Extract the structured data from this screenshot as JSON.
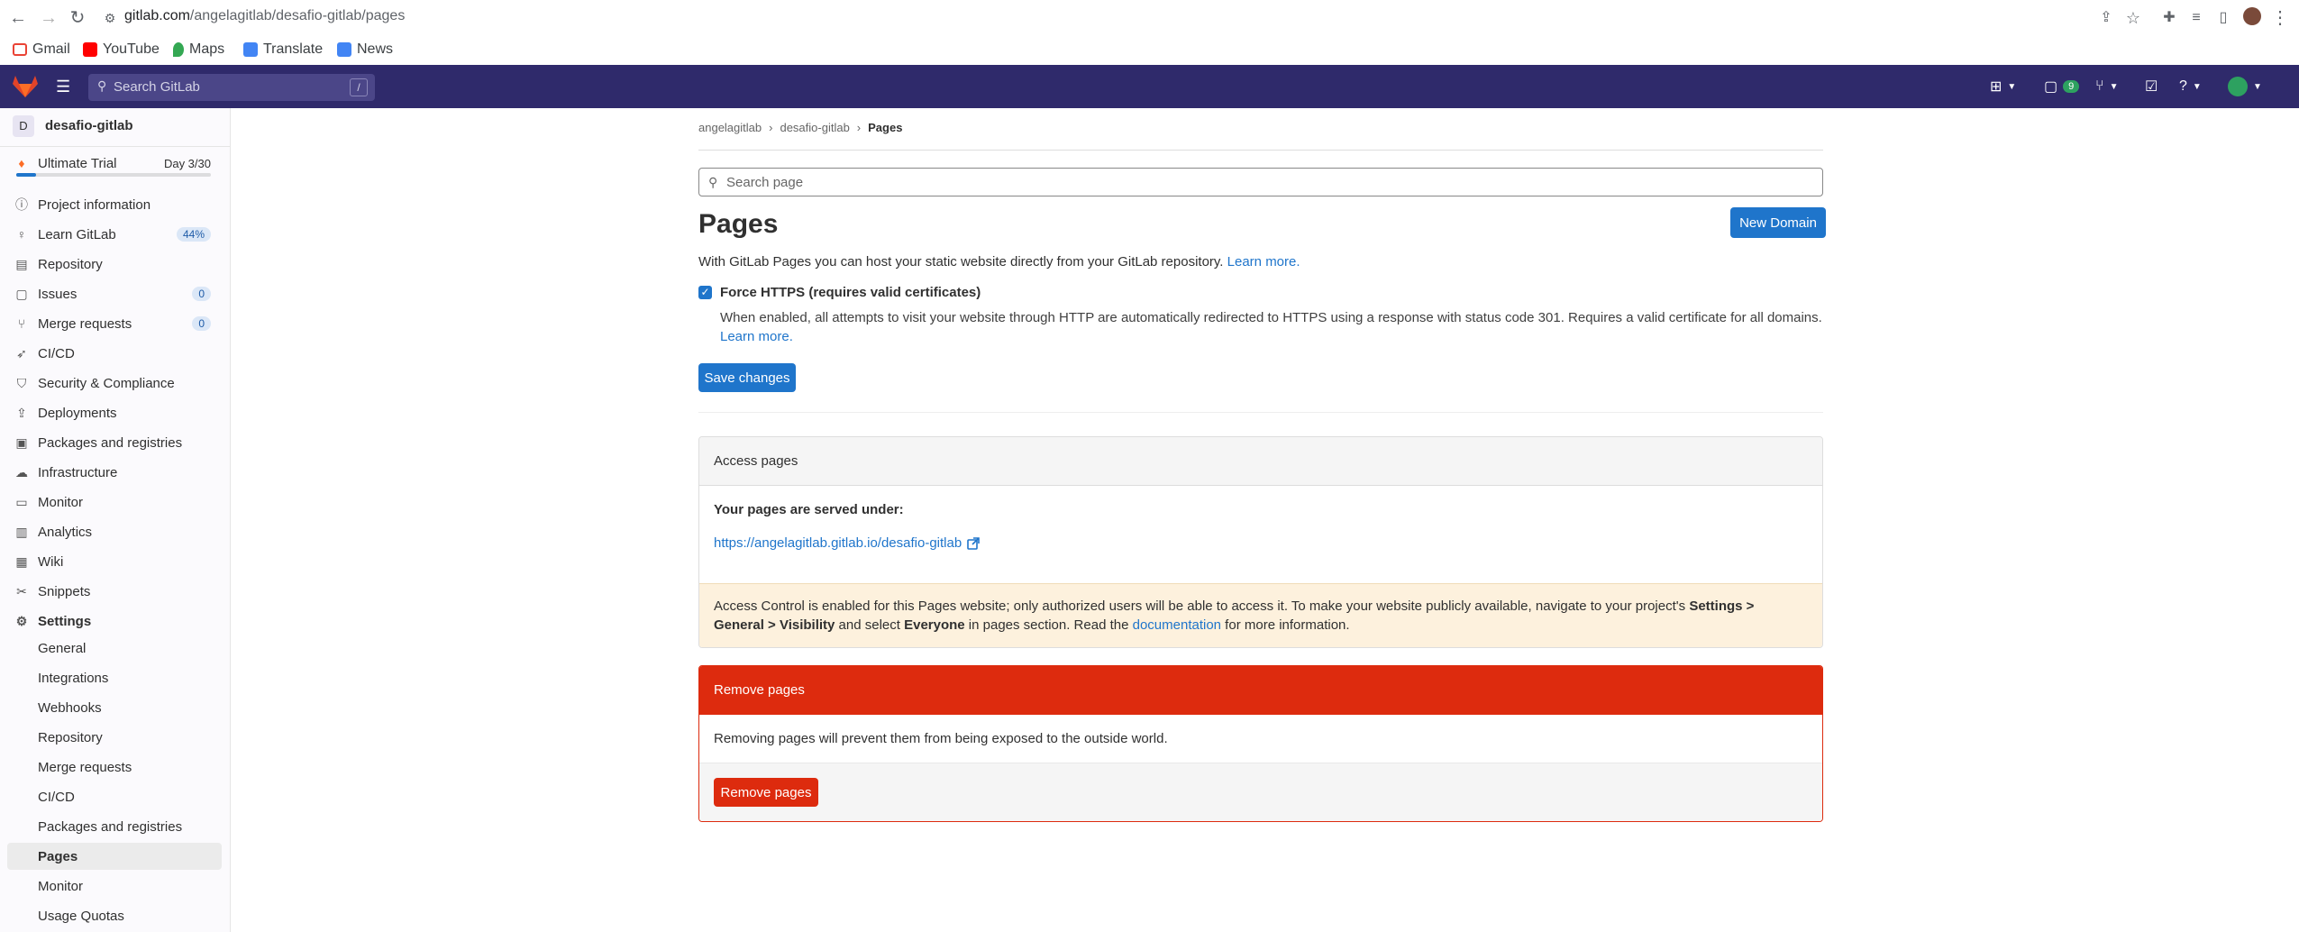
{
  "browser": {
    "url_host": "gitlab.com",
    "url_path": "/angelagitlab/desafio-gitlab/pages",
    "bookmarks": [
      {
        "label": "Gmail",
        "icon": "gmail-icon",
        "color": "#ea4335"
      },
      {
        "label": "YouTube",
        "icon": "youtube-icon",
        "color": "#ff0000"
      },
      {
        "label": "Maps",
        "icon": "maps-icon",
        "color": "#34a853"
      },
      {
        "label": "Translate",
        "icon": "translate-icon",
        "color": "#4285f4"
      },
      {
        "label": "News",
        "icon": "news-icon",
        "color": "#4285f4"
      }
    ]
  },
  "topbar": {
    "search_placeholder": "Search GitLab",
    "search_shortcut": "/",
    "issues_count": "9"
  },
  "sidebar": {
    "project_initial": "D",
    "project_name": "desafio-gitlab",
    "trial_label": "Ultimate Trial",
    "trial_days": "Day 3/30",
    "trial_progress": 0.1,
    "items": [
      {
        "label": "Project information",
        "icon": "info-icon"
      },
      {
        "label": "Learn GitLab",
        "icon": "bulb-icon",
        "badge": "44%"
      },
      {
        "label": "Repository",
        "icon": "doc-icon"
      },
      {
        "label": "Issues",
        "icon": "issues-icon",
        "badge": "0"
      },
      {
        "label": "Merge requests",
        "icon": "merge-icon",
        "badge": "0"
      },
      {
        "label": "CI/CD",
        "icon": "rocket-icon"
      },
      {
        "label": "Security & Compliance",
        "icon": "shield-icon"
      },
      {
        "label": "Deployments",
        "icon": "deploy-icon"
      },
      {
        "label": "Packages and registries",
        "icon": "package-icon"
      },
      {
        "label": "Infrastructure",
        "icon": "cloud-icon"
      },
      {
        "label": "Monitor",
        "icon": "monitor-icon"
      },
      {
        "label": "Analytics",
        "icon": "chart-icon"
      },
      {
        "label": "Wiki",
        "icon": "book-icon"
      },
      {
        "label": "Snippets",
        "icon": "scissors-icon"
      },
      {
        "label": "Settings",
        "icon": "gear-icon"
      }
    ],
    "settings_sub": [
      "General",
      "Integrations",
      "Webhooks",
      "Repository",
      "Merge requests",
      "CI/CD",
      "Packages and registries",
      "Pages",
      "Monitor",
      "Usage Quotas"
    ]
  },
  "main": {
    "breadcrumb": [
      "angelagitlab",
      "desafio-gitlab",
      "Pages"
    ],
    "search_placeholder": "Search page",
    "title": "Pages",
    "new_domain_label": "New Domain",
    "description": "With GitLab Pages you can host your static website directly from your GitLab repository.",
    "learn_more": "Learn more.",
    "force_https_label": "Force HTTPS (requires valid certificates)",
    "force_https_help": "When enabled, all attempts to visit your website through HTTP are automatically redirected to HTTPS using a response with status code 301. Requires a valid certificate for all domains.",
    "force_https_learn": "Learn more.",
    "save_label": "Save changes",
    "access": {
      "header": "Access pages",
      "served_label": "Your pages are served under:",
      "url": "https://angelagitlab.gitlab.io/desafio-gitlab",
      "warn_1": "Access Control is enabled for this Pages website; only authorized users will be able to access it. To make your website publicly available, navigate to your project's ",
      "warn_bold_1": "Settings > General > Visibility",
      "warn_2": " and select ",
      "warn_bold_2": "Everyone",
      "warn_3": " in pages section. Read the ",
      "warn_link": "documentation",
      "warn_4": " for more information."
    },
    "remove": {
      "header": "Remove pages",
      "body": "Removing pages will prevent them from being exposed to the outside world.",
      "button": "Remove pages"
    }
  }
}
